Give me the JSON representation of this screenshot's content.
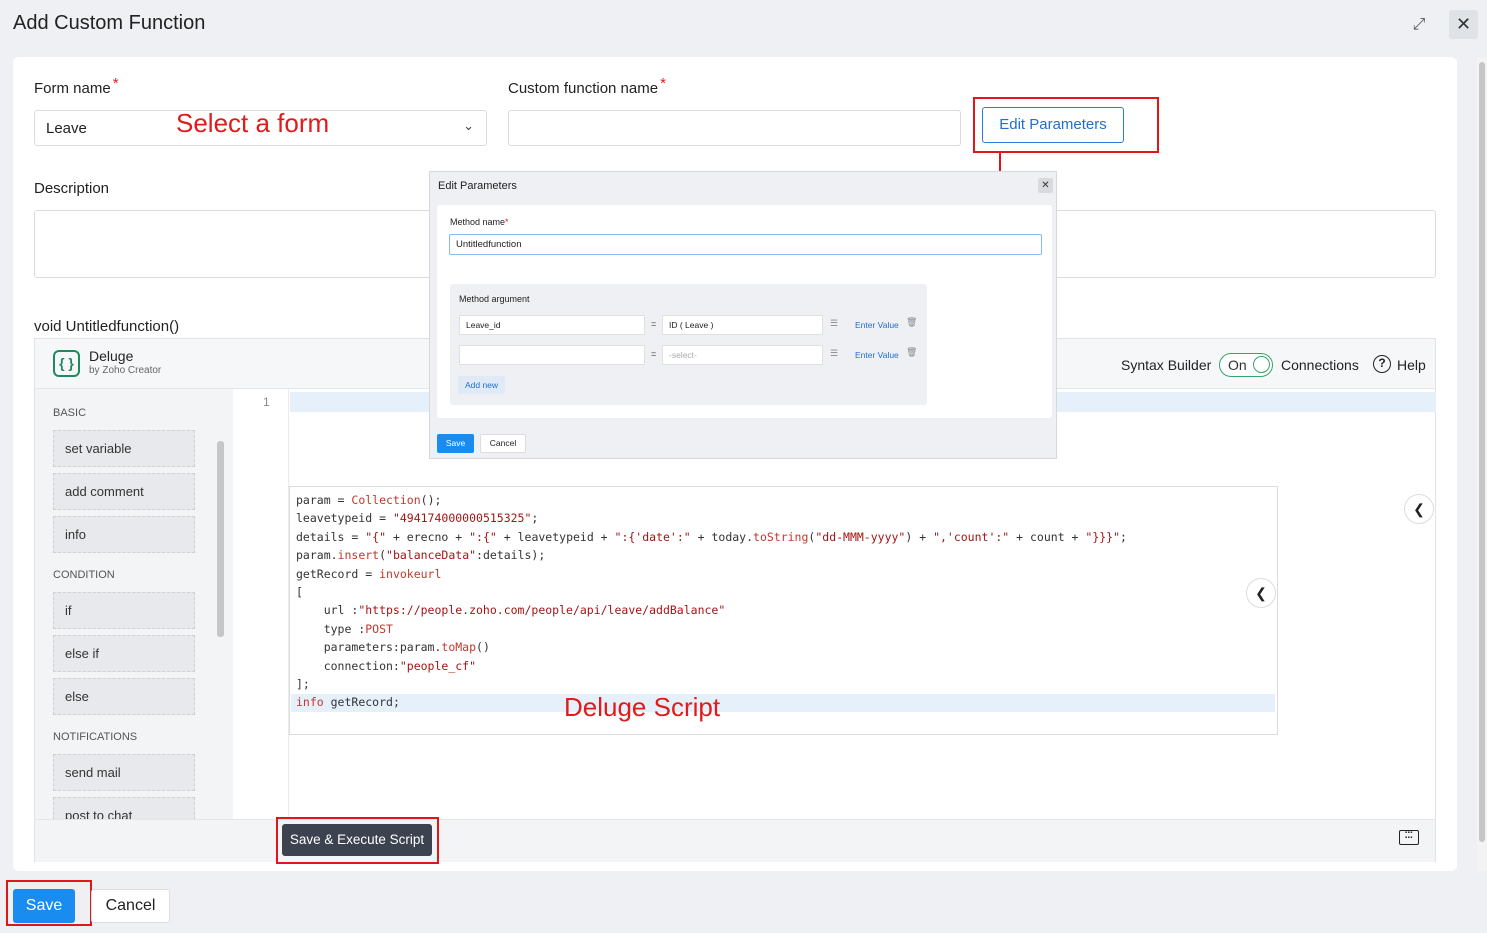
{
  "header": {
    "title": "Add Custom Function",
    "expand_icon": "expand-icon",
    "close_icon": "close-icon",
    "close_glyph": "✕"
  },
  "form": {
    "form_name_label": "Form name",
    "form_name_value": "Leave",
    "custom_fn_label": "Custom function name",
    "custom_fn_value": "",
    "edit_params_label": "Edit Parameters",
    "description_label": "Description",
    "description_value": "",
    "required_mark": "*"
  },
  "annotations": {
    "select_form": "Select a form",
    "deluge_script": "Deluge Script",
    "color": "#e0161b"
  },
  "editor": {
    "signature": "void Untitledfunction()",
    "brand_name": "Deluge",
    "brand_sub": "by Zoho Creator",
    "syntax_builder_label": "Syntax Builder",
    "toggle_label": "On",
    "connections_label": "Connections",
    "help_label": "Help",
    "line_number": "1",
    "sidebar": [
      {
        "category": "BASIC",
        "items": [
          "set variable",
          "add comment",
          "info"
        ]
      },
      {
        "category": "CONDITION",
        "items": [
          "if",
          "else if",
          "else"
        ]
      },
      {
        "category": "NOTIFICATIONS",
        "items": [
          "send mail",
          "post to chat"
        ]
      }
    ],
    "save_execute_label": "Save & Execute Script"
  },
  "code": [
    "param = Collection();",
    "leavetypeid = \"494174000000515325\";",
    "details = \"{\" + erecno + \":{\" + leavetypeid + \":{'date':\" + today.toString(\"dd-MMM-yyyy\") + \",'count':\" + count + \"}}}\";",
    "param.insert(\"balanceData\":details);",
    "getRecord = invokeurl",
    "[",
    "    url :\"https://people.zoho.com/people/api/leave/addBalance\"",
    "    type :POST",
    "    parameters:param.toMap()",
    "    connection:\"people_cf\"",
    "];",
    "info getRecord;"
  ],
  "popup": {
    "title": "Edit Parameters",
    "method_name_label": "Method name",
    "method_name_value": "Untitledfunction",
    "method_argument_label": "Method argument",
    "args": [
      {
        "name": "Leave_id",
        "type": "ID ( Leave )",
        "enter_value": "Enter Value"
      },
      {
        "name": "",
        "type": "-select-",
        "enter_value": "Enter Value"
      }
    ],
    "equals": "=",
    "add_new_label": "Add new",
    "save_label": "Save",
    "cancel_label": "Cancel"
  },
  "footer": {
    "save_label": "Save",
    "cancel_label": "Cancel"
  }
}
